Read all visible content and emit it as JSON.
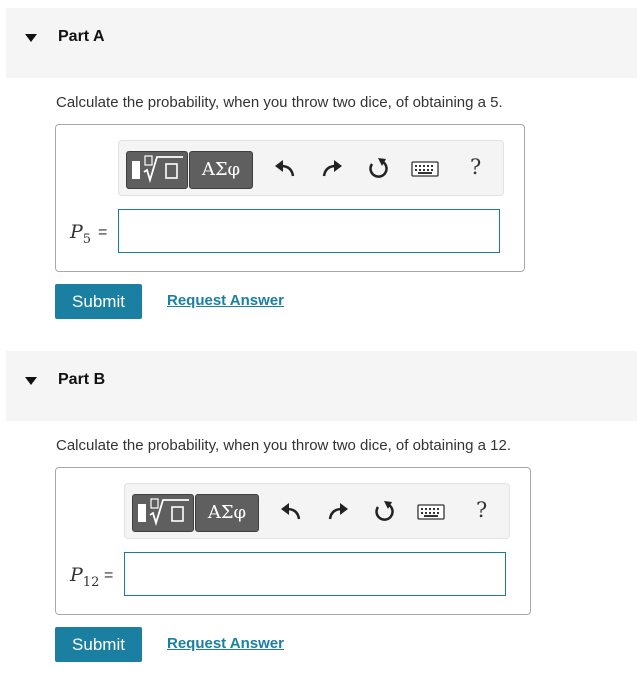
{
  "parts": [
    {
      "title": "Part A",
      "question": "Calculate the probability, when you throw two dice, of obtaining a 5.",
      "variable": {
        "symbol": "P",
        "subscript": "5",
        "equals": "="
      },
      "input_value": "",
      "toolbar": {
        "greek_label": "ΑΣφ",
        "help_label": "?"
      },
      "submit_label": "Submit",
      "request_label": "Request Answer"
    },
    {
      "title": "Part B",
      "question": "Calculate the probability, when you throw two dice, of obtaining a 12.",
      "variable": {
        "symbol": "P",
        "subscript": "12",
        "equals": "="
      },
      "input_value": "",
      "toolbar": {
        "greek_label": "ΑΣφ",
        "help_label": "?"
      },
      "submit_label": "Submit",
      "request_label": "Request Answer"
    }
  ],
  "colors": {
    "accent": "#1a7fa1",
    "header_bg": "#f5f5f5",
    "tool_bg": "#5f5f5f"
  },
  "icons": [
    "templates-icon",
    "undo-icon",
    "redo-icon",
    "reset-icon",
    "keyboard-icon",
    "help-icon"
  ]
}
